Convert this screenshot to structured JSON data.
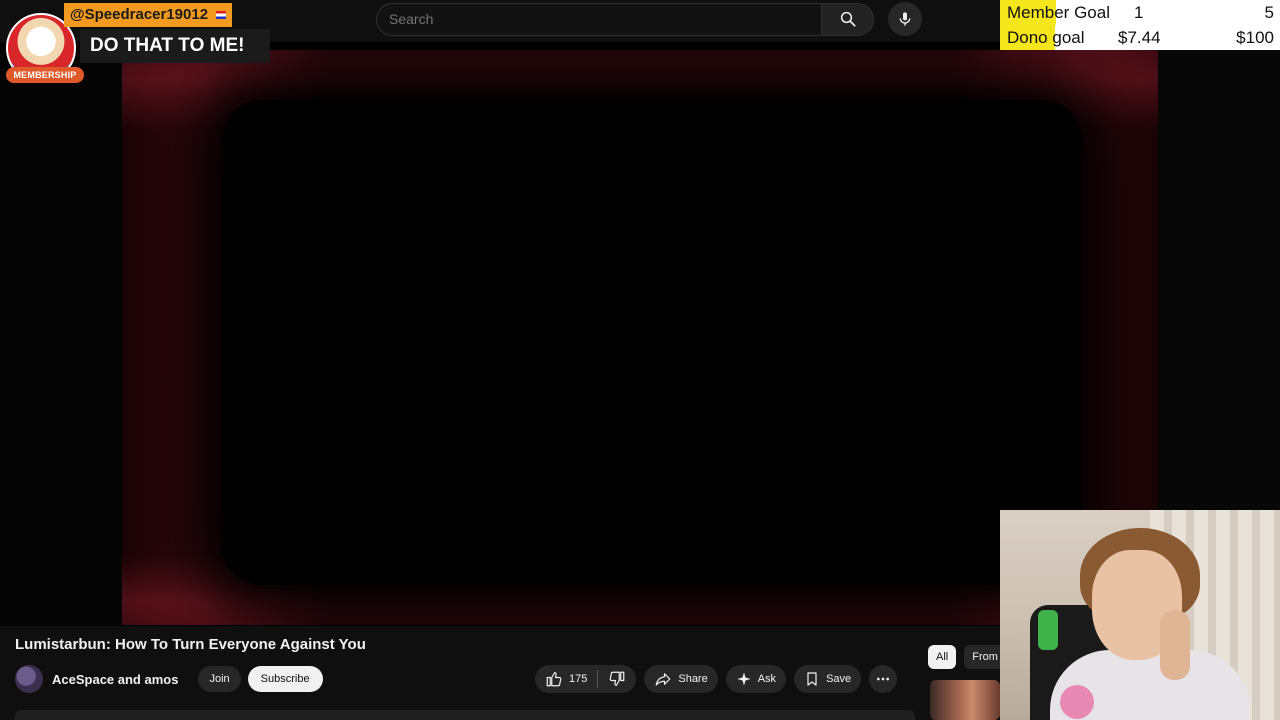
{
  "search": {
    "placeholder": "Search"
  },
  "alert": {
    "username": "@Speedracer19012",
    "message": "DO THAT TO ME!",
    "badge": "MEMBERSHIP"
  },
  "goals": [
    {
      "label": "Member Goal",
      "current": "1",
      "target": "5",
      "progress": 0.2
    },
    {
      "label": "Dono goal",
      "current": "$7.44",
      "target": "$100",
      "progress": 0.0744
    }
  ],
  "video": {
    "title": "Lumistarbun: How To Turn Everyone Against You",
    "channel": "AceSpace and amos",
    "join_label": "Join",
    "subscribe_label": "Subscribe",
    "like_count": "175",
    "share_label": "Share",
    "ask_label": "Ask",
    "save_label": "Save"
  },
  "chips": {
    "all": "All",
    "from": "From"
  },
  "colors": {
    "background": "#0f0f0f",
    "goal_fill": "#f5e51b",
    "alert_user_bg": "#f29a1f"
  }
}
